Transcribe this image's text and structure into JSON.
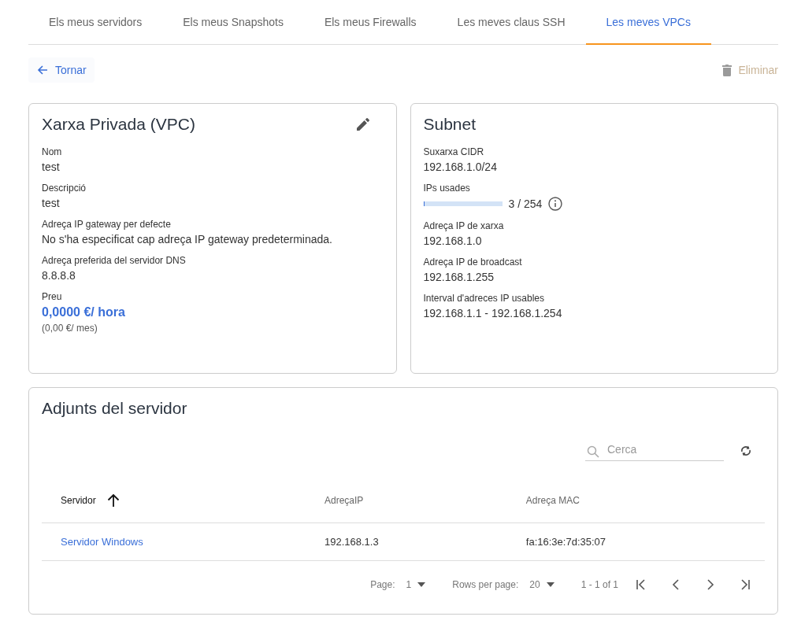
{
  "tabs": [
    {
      "label": "Els meus servidors",
      "selected": false
    },
    {
      "label": "Els meus Snapshots",
      "selected": false
    },
    {
      "label": "Els meus Firewalls",
      "selected": false
    },
    {
      "label": "Les meves claus SSH",
      "selected": false
    },
    {
      "label": "Les meves VPCs",
      "selected": true
    }
  ],
  "back_button": {
    "label": "Tornar"
  },
  "delete_button": {
    "label": "Eliminar",
    "disabled": true
  },
  "vpc_card": {
    "title": "Xarxa Privada (VPC)",
    "fields": [
      {
        "label": "Nom",
        "value": "test"
      },
      {
        "label": "Descripció",
        "value": "test"
      },
      {
        "label": "Adreça IP gateway per defecte",
        "value": "No s'ha especificat cap adreça IP gateway predeterminada."
      },
      {
        "label": "Adreça preferida del servidor DNS",
        "value": "8.8.8.8"
      }
    ],
    "price": {
      "label": "Preu",
      "value": "0,0000 €/ hora",
      "monthly": "(0,00 €/ mes)"
    }
  },
  "subnet_card": {
    "title": "Subnet",
    "fields": [
      {
        "kind": "text",
        "label": "Suxarxa CIDR",
        "value": "192.168.1.0/24"
      },
      {
        "kind": "meter",
        "label": "IPs usades",
        "level": 0.012,
        "reading": "3 / 254"
      },
      {
        "kind": "text",
        "label": "Adreça IP de xarxa",
        "value": "192.168.1.0"
      },
      {
        "kind": "text",
        "label": "Adreça IP de broadcast",
        "value": "192.168.1.255"
      },
      {
        "kind": "text",
        "label": "Interval d'adreces IP usables",
        "value": "192.168.1.1 - 192.168.1.254"
      }
    ]
  },
  "attachments": {
    "title": "Adjunts del servidor",
    "search": {
      "placeholder": "Cerca"
    },
    "table": {
      "columns": [
        {
          "label": "Servidor",
          "sorted": true
        },
        {
          "label": "AdreçaIP",
          "sorted": false
        },
        {
          "label": "Adreça MAC",
          "sorted": false
        }
      ],
      "rows": [
        [
          "Servidor Windows",
          "192.168.1.3",
          "fa:16:3e:7d:35:07"
        ]
      ]
    },
    "pagination": {
      "page_label": "Page:",
      "page": "1",
      "rows_label": "Rows per page:",
      "rows_per_page": "20",
      "range": "1 - 1 of 1"
    }
  }
}
